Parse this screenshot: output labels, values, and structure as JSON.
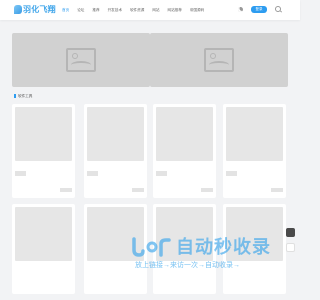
{
  "header": {
    "logo_text": "羽化飞翔",
    "nav": [
      "首页",
      "论坛",
      "推荐",
      "开发技术",
      "软件资源",
      "网站",
      "网站推荐",
      "帝国源码"
    ],
    "login_label": "登录"
  },
  "section": {
    "title": "软件工具"
  },
  "watermark": {
    "big_text": "自动秒收录",
    "small_text": "放上链接→来访一次→自动收录→"
  },
  "colors": {
    "accent": "#2d9cf0",
    "background": "#f2f3f5",
    "placeholder": "#d1d1d1"
  }
}
